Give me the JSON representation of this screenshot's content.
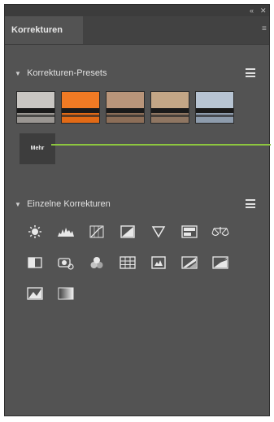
{
  "panel": {
    "tab_label": "Korrekturen",
    "window_controls": [
      "«",
      "✕"
    ],
    "tab_menu_symbol": "≡"
  },
  "presets_section": {
    "title": "Korrekturen-Presets",
    "more_label": "Mehr",
    "thumbnails": [
      {
        "name": "preset-1",
        "sky": "#c9c6c2",
        "water": "#9a9692"
      },
      {
        "name": "preset-2",
        "sky": "#f07a24",
        "water": "#e26a16"
      },
      {
        "name": "preset-3",
        "sky": "#b9957a",
        "water": "#8c6e58"
      },
      {
        "name": "preset-4",
        "sky": "#c3a686",
        "water": "#8f7662"
      },
      {
        "name": "preset-5",
        "sky": "#b7c4d3",
        "water": "#8e9cad"
      }
    ]
  },
  "single_section": {
    "title": "Einzelne Korrekturen"
  },
  "adjustment_icons": [
    "brightness-contrast-icon",
    "levels-icon",
    "curves-icon",
    "exposure-icon",
    "vibrance-icon",
    "hue-saturation-icon",
    "color-balance-icon",
    "black-white-icon",
    "photo-filter-icon",
    "channel-mixer-icon",
    "color-lookup-icon",
    "invert-icon",
    "posterize-icon",
    "threshold-icon",
    "selective-color-icon",
    "gradient-map-icon"
  ],
  "colors": {
    "panel_bg": "#535353",
    "accent_line": "#8dc63f"
  }
}
